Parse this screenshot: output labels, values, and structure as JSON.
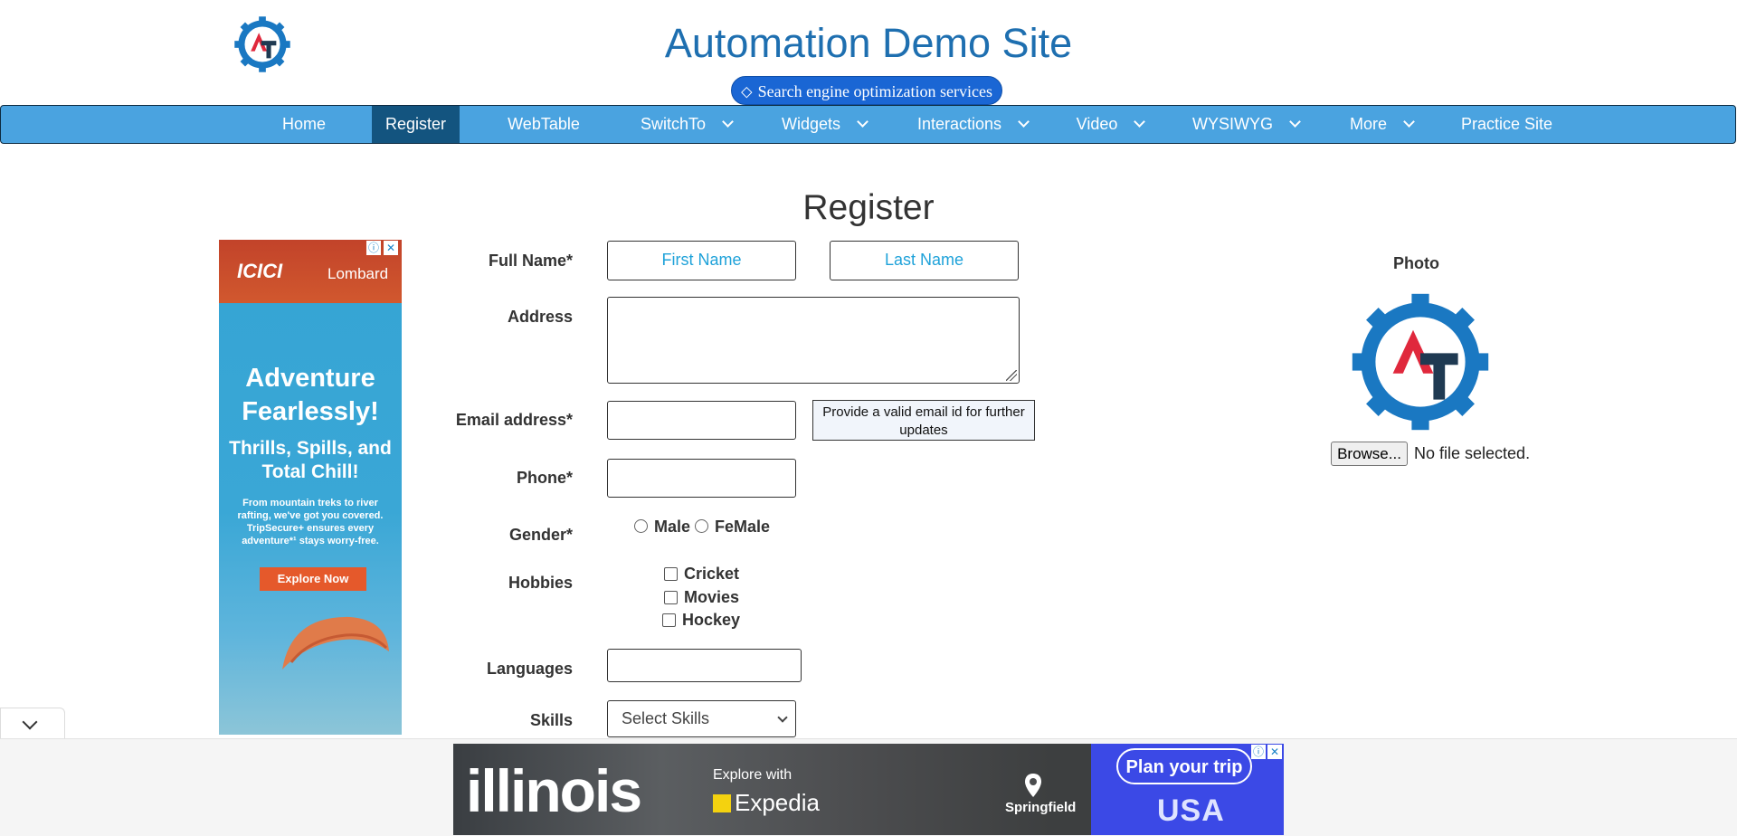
{
  "header": {
    "site_title": "Automation Demo Site",
    "seo_badge": "Search engine optimization services",
    "logo_letters": "AT"
  },
  "nav": {
    "items": [
      {
        "label": "Home",
        "dropdown": false,
        "active": false
      },
      {
        "label": "Register",
        "dropdown": false,
        "active": true
      },
      {
        "label": "WebTable",
        "dropdown": false,
        "active": false
      },
      {
        "label": "SwitchTo",
        "dropdown": true,
        "active": false
      },
      {
        "label": "Widgets",
        "dropdown": true,
        "active": false
      },
      {
        "label": "Interactions",
        "dropdown": true,
        "active": false
      },
      {
        "label": "Video",
        "dropdown": true,
        "active": false
      },
      {
        "label": "WYSIWYG",
        "dropdown": true,
        "active": false
      },
      {
        "label": "More",
        "dropdown": true,
        "active": false
      },
      {
        "label": "Practice Site",
        "dropdown": false,
        "active": false
      }
    ]
  },
  "form": {
    "heading": "Register",
    "full_name_label": "Full Name*",
    "first_name_placeholder": "First Name",
    "last_name_placeholder": "Last Name",
    "address_label": "Address",
    "email_label": "Email address*",
    "email_hint": "Provide a valid email id for further updates",
    "phone_label": "Phone*",
    "gender_label": "Gender*",
    "gender_options": [
      "Male",
      "FeMale"
    ],
    "hobbies_label": "Hobbies",
    "hobbies": [
      "Cricket",
      "Movies",
      "Hockey"
    ],
    "languages_label": "Languages",
    "skills_label": "Skills",
    "skills_selected": "Select Skills"
  },
  "photo": {
    "label": "Photo",
    "browse_button": "Browse...",
    "file_status": "No file selected."
  },
  "ads": {
    "left": {
      "brand": "ICICI",
      "brand_suffix": "Lombard",
      "headline": "Adventure Fearlessly!",
      "subline": "Thrills, Spills, and Total Chill!",
      "small_text": "From mountain treks to river rafting, we've got you covered. TripSecure+ ensures every adventure*¹ stays worry-free.",
      "cta": "Explore Now"
    },
    "bottom": {
      "title": "illinois",
      "explore_with": "Explore with",
      "partner": "Expedia",
      "city": "Springfield",
      "cta": "Plan your trip",
      "usa": "USA"
    }
  },
  "colors": {
    "nav_bg": "#4aa3e0",
    "nav_active": "#13547f",
    "title_blue": "#1e6fb0",
    "logo_red": "#e0283c",
    "logo_dark": "#1f3a52",
    "placeholder_blue": "#1fa2d9"
  }
}
